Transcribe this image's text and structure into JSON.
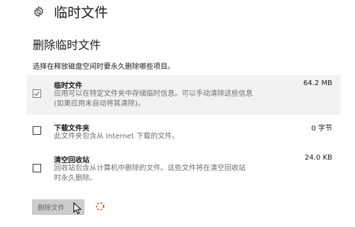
{
  "header": {
    "icon": "gear-icon",
    "title": "临时文件"
  },
  "section": {
    "title": "删除临时文件",
    "instruction": "选择在释放磁盘空间时要永久删除哪些项目。"
  },
  "items": [
    {
      "name": "临时文件",
      "size": "64.2 MB",
      "checked": true,
      "description_lines": [
        "应用可以在特定文件夹中存储临时信息。可以手动清除这些信息",
        "(如果应用未自动将其清除)。"
      ]
    },
    {
      "name": "下载文件夹",
      "size": "0 字节",
      "checked": false,
      "description_lines": [
        "此文件夹包含从 Internet 下载的文件。"
      ]
    },
    {
      "name": "清空回收站",
      "size": "24.0 KB",
      "checked": false,
      "description_lines": [
        "回收站包含从计算机中删除的文件。这些文件将在清空回收站",
        "时永久删除。"
      ]
    }
  ],
  "actions": {
    "delete_label": "删除文件"
  },
  "icons": {
    "cursor": "mouse-pointer-icon",
    "spinner": "loading-spinner-icon"
  },
  "colors": {
    "spinner_accent": "#d83b01",
    "button_bg": "#cccccc"
  }
}
